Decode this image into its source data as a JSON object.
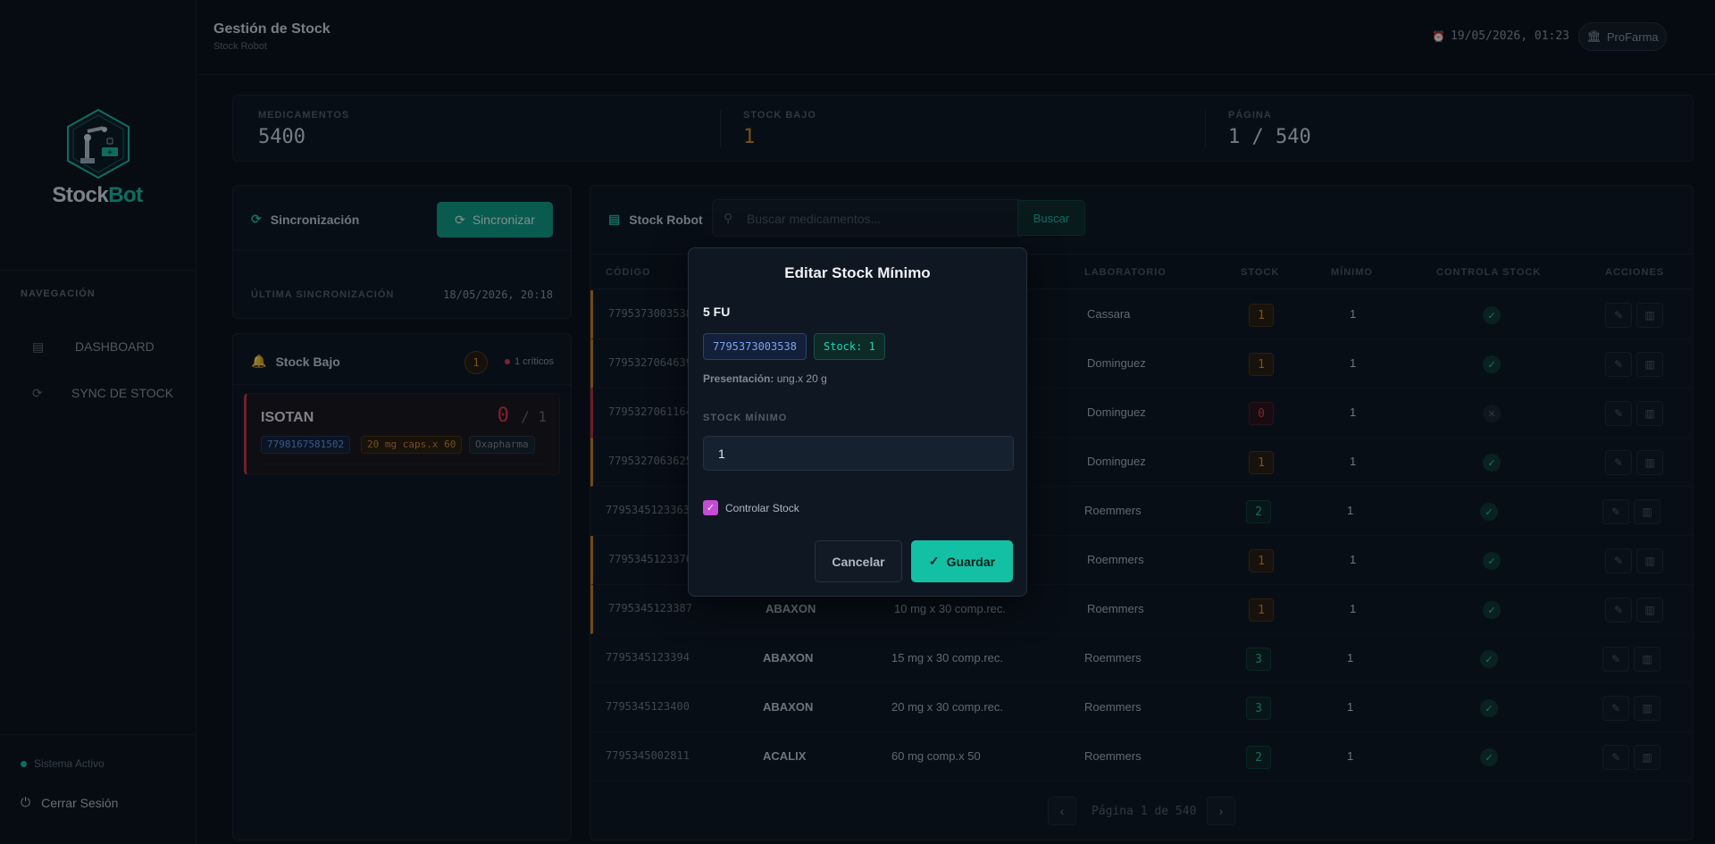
{
  "brand": {
    "name_part1": "Stock",
    "name_part2": "Bot"
  },
  "sidebar": {
    "nav_heading": "NAVEGACIÓN",
    "items": [
      {
        "label": "DASHBOARD",
        "icon": "clipboard-icon"
      },
      {
        "label": "SYNC DE STOCK",
        "icon": "refresh-icon"
      }
    ],
    "status": "Sistema Activo",
    "logout": "Cerrar Sesión"
  },
  "header": {
    "title": "Gestión de Stock",
    "subtitle": "Stock Robot",
    "datetime": "19/05/2026, 01:23",
    "pharmacy": "ProFarma"
  },
  "stats": [
    {
      "label": "MEDICAMENTOS",
      "value": "5400",
      "color": "#d4dde5"
    },
    {
      "label": "STOCK BAJO",
      "value": "1",
      "color": "#e1901a"
    },
    {
      "label": "PÁGINA",
      "value": "1 / 540",
      "color": "#d4dde5"
    }
  ],
  "sync": {
    "title": "Sincronización",
    "button": "Sincronizar",
    "last_label": "ÚLTIMA SINCRONIZACIÓN",
    "last_value": "18/05/2026, 20:18"
  },
  "low_stock": {
    "title": "Stock Bajo",
    "count": "1",
    "critical": "1 críticos",
    "items": [
      {
        "name": "ISOTAN",
        "stock": "0",
        "min": "/ 1",
        "code": "7798167581502",
        "presentation": "20 mg caps.x 60",
        "lab": "Oxapharma"
      }
    ]
  },
  "table": {
    "title": "Stock Robot",
    "search_placeholder": "Buscar medicamentos...",
    "search_button": "Buscar",
    "headers": [
      "CÓDIGO",
      "LABORATORIO",
      "STOCK",
      "MÍNIMO",
      "CONTROLA STOCK",
      "ACCIONES"
    ],
    "rows": [
      {
        "code": "7795373003538",
        "name": "",
        "presentation": "",
        "lab": "Cassara",
        "stock": "1",
        "min": "1",
        "controls": true,
        "status": "warn"
      },
      {
        "code": "7795327064639",
        "name": "",
        "presentation": "",
        "lab": "Dominguez",
        "stock": "1",
        "min": "1",
        "controls": true,
        "status": "warn"
      },
      {
        "code": "7795327061164",
        "name": "",
        "presentation": "",
        "lab": "Dominguez",
        "stock": "0",
        "min": "1",
        "controls": false,
        "status": "crit"
      },
      {
        "code": "7795327063625",
        "name": "",
        "presentation": "",
        "lab": "Dominguez",
        "stock": "1",
        "min": "1",
        "controls": true,
        "status": "warn"
      },
      {
        "code": "7795345123363",
        "name": "",
        "presentation": "",
        "lab": "Roemmers",
        "stock": "2",
        "min": "1",
        "controls": true,
        "status": "ok"
      },
      {
        "code": "7795345123370",
        "name": "",
        "presentation": "",
        "lab": "Roemmers",
        "stock": "1",
        "min": "1",
        "controls": true,
        "status": "warn"
      },
      {
        "code": "7795345123387",
        "name": "ABAXON",
        "presentation": "10 mg x 30 comp.rec.",
        "lab": "Roemmers",
        "stock": "1",
        "min": "1",
        "controls": true,
        "status": "warn"
      },
      {
        "code": "7795345123394",
        "name": "ABAXON",
        "presentation": "15 mg x 30 comp.rec.",
        "lab": "Roemmers",
        "stock": "3",
        "min": "1",
        "controls": true,
        "status": "ok"
      },
      {
        "code": "7795345123400",
        "name": "ABAXON",
        "presentation": "20 mg x 30 comp.rec.",
        "lab": "Roemmers",
        "stock": "3",
        "min": "1",
        "controls": true,
        "status": "ok"
      },
      {
        "code": "7795345002811",
        "name": "ACALIX",
        "presentation": "60 mg comp.x 50",
        "lab": "Roemmers",
        "stock": "2",
        "min": "1",
        "controls": true,
        "status": "ok"
      }
    ],
    "pagination": "Página 1 de 540"
  },
  "modal": {
    "title": "Editar Stock Mínimo",
    "product": "5 FU",
    "code": "7795373003538",
    "stock_tag": "Stock: 1",
    "presentation_label": "Presentación:",
    "presentation_value": "ung.x 20 g",
    "field_label": "STOCK MÍNIMO",
    "field_value": "1",
    "checkbox_label": "Controlar Stock",
    "checkbox_checked": true,
    "cancel": "Cancelar",
    "save": "Guardar"
  },
  "colors": {
    "accent": "#18c2a5",
    "warning": "#e1901a",
    "critical": "#e63a52",
    "checkbox": "#c64bd6"
  }
}
